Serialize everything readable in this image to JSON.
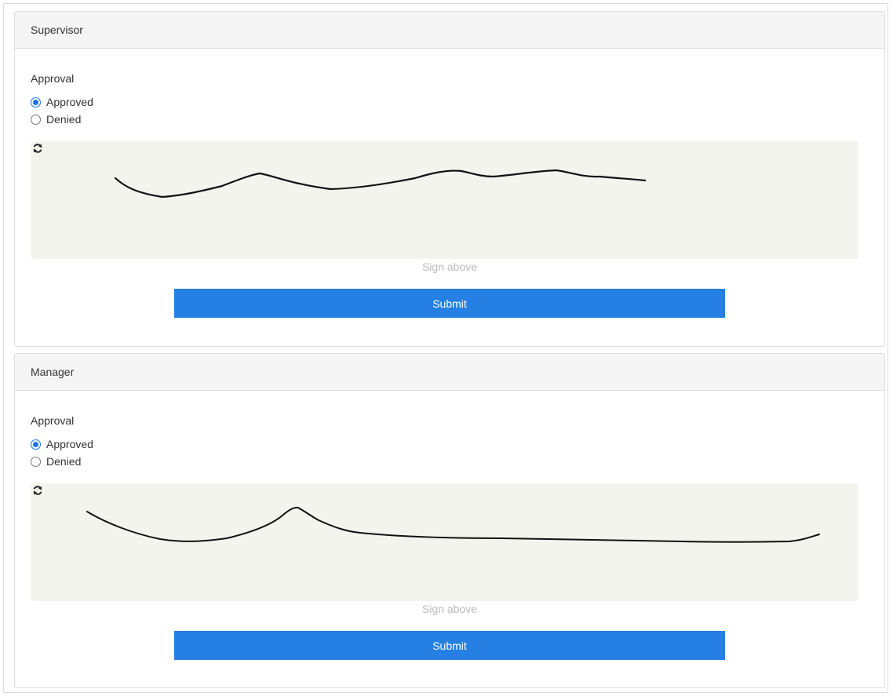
{
  "sections": [
    {
      "title": "Supervisor",
      "approval_label": "Approval",
      "options": [
        {
          "label": "Approved",
          "checked": true
        },
        {
          "label": "Denied",
          "checked": false
        }
      ],
      "signature_hint": "Sign above",
      "submit_label": "Submit"
    },
    {
      "title": "Manager",
      "approval_label": "Approval",
      "options": [
        {
          "label": "Approved",
          "checked": true
        },
        {
          "label": "Denied",
          "checked": false
        }
      ],
      "signature_hint": "Sign above",
      "submit_label": "Submit"
    }
  ],
  "icons": {
    "reset": "refresh-icon"
  },
  "colors": {
    "primary": "#2680e3",
    "signature_pad_bg": "#f4f4ee",
    "radio_checked": "#1a73e8",
    "hint_text": "#bbbbbb"
  }
}
